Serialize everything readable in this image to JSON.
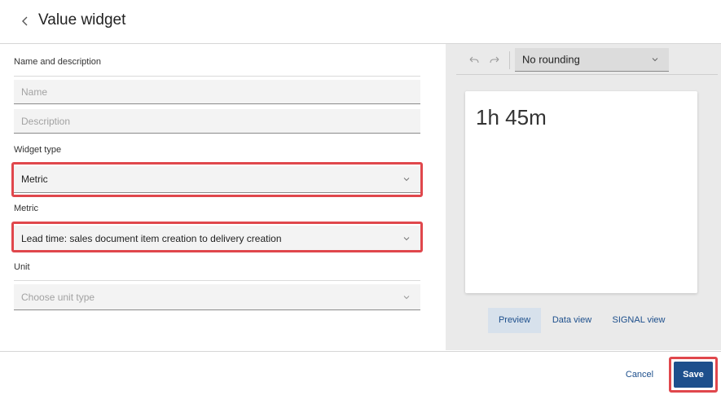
{
  "header": {
    "title": "Value widget",
    "back_icon": "chevron-left-icon"
  },
  "form": {
    "name_section_label": "Name and description",
    "name_placeholder": "Name",
    "description_placeholder": "Description",
    "widget_type_label": "Widget type",
    "widget_type_value": "Metric",
    "metric_label": "Metric",
    "metric_value": "Lead time: sales document item creation to delivery creation",
    "unit_label": "Unit",
    "unit_placeholder": "Choose unit type"
  },
  "preview": {
    "toolbar": {
      "undo_icon": "undo-icon",
      "redo_icon": "redo-icon",
      "rounding_value": "No rounding"
    },
    "value": "1h 45m",
    "tabs": [
      "Preview",
      "Data view",
      "SIGNAL view"
    ],
    "active_tab": "Preview"
  },
  "footer": {
    "cancel_label": "Cancel",
    "save_label": "Save"
  },
  "colors": {
    "accent": "#1d4f8c",
    "highlight": "#e0474c",
    "panel_bg": "#eaeaea"
  }
}
